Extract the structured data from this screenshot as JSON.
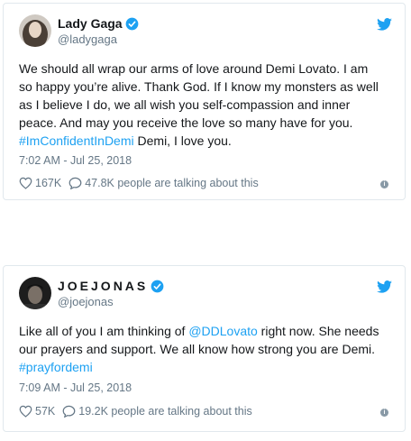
{
  "colors": {
    "accent": "#1da1f2",
    "muted": "#657786",
    "border": "#e1e8ed"
  },
  "tweets": [
    {
      "name": "Lady Gaga",
      "handle": "@ladygaga",
      "verified": true,
      "lines": [
        "We should all wrap our arms of love around Demi Lovato. I am",
        "so happy you’re alive. Thank God. If I know my monsters as well",
        "as I believe I do, we all wish you self-compassion and inner",
        "peace. And may you receive the love so many have for you."
      ],
      "hashtag": "#ImConfidentInDemi",
      "after_hashtag": " Demi, I love you.",
      "date": "7:02 AM - Jul 25, 2018",
      "likes": "167K",
      "talking": "47.8K people are talking about this"
    },
    {
      "name": "JOEJONAS",
      "handle": "@joejonas",
      "verified": true,
      "line1_pre": "Like all of you I am thinking of ",
      "mention": "@DDLovato",
      "line1_post": " right now. She needs",
      "line2": "our prayers and support. We all know how strong you are Demi.",
      "hashtag": "#prayfordemi",
      "date": "7:09 AM - Jul 25, 2018",
      "likes": "57K",
      "talking": "19.2K people are talking about this"
    }
  ]
}
